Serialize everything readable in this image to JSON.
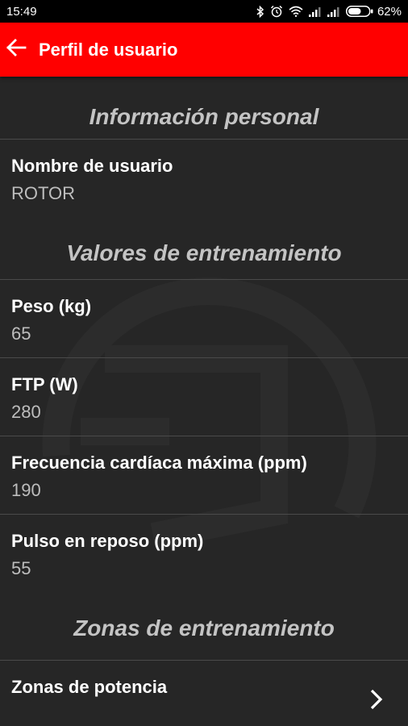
{
  "status_bar": {
    "time": "15:49",
    "battery_percent": "62%",
    "battery_level": 0.62,
    "icons": [
      "bluetooth-icon",
      "alarm-icon",
      "wifi-icon",
      "signal-icon",
      "signal-icon",
      "battery-icon"
    ]
  },
  "app_bar": {
    "title": "Perfil de usuario",
    "back_icon": "arrow-left-icon",
    "color": "#ff0000"
  },
  "sections": {
    "personal": {
      "title": "Información personal",
      "username_label": "Nombre de usuario",
      "username_value": "ROTOR"
    },
    "training_values": {
      "title": "Valores de entrenamiento",
      "weight_label": "Peso (kg)",
      "weight_value": "65",
      "ftp_label": "FTP (W)",
      "ftp_value": "280",
      "max_hr_label": "Frecuencia cardíaca máxima (ppm)",
      "max_hr_value": "190",
      "rest_hr_label": "Pulso en reposo (ppm)",
      "rest_hr_value": "55"
    },
    "training_zones": {
      "title": "Zonas de entrenamiento",
      "power_zones_label": "Zonas de potencia",
      "chevron_icon": "chevron-right-icon"
    }
  }
}
